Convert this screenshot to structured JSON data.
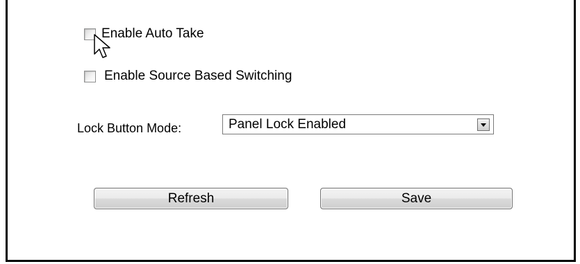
{
  "options": {
    "auto_take": {
      "label": "Enable Auto Take",
      "checked": false
    },
    "source_switching": {
      "label": "Enable Source Based Switching",
      "checked": false
    }
  },
  "lock_mode": {
    "label": "Lock Button Mode:",
    "selected": "Panel Lock Enabled"
  },
  "buttons": {
    "refresh": "Refresh",
    "save": "Save"
  },
  "icons": {
    "cursor": "arrow-cursor-icon",
    "dropdown": "chevron-down-icon"
  }
}
